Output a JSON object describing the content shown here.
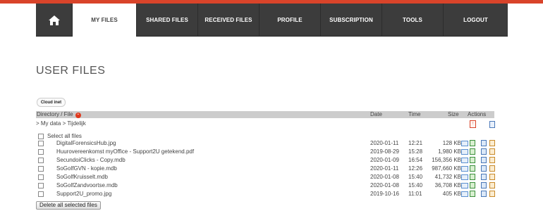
{
  "nav": {
    "items": [
      {
        "label": "MY FILES"
      },
      {
        "label": "SHARED FILES"
      },
      {
        "label": "RECEIVED FILES"
      },
      {
        "label": "PROFILE"
      },
      {
        "label": "SUBSCRIPTION"
      },
      {
        "label": "TOOLS"
      },
      {
        "label": "LOGOUT"
      }
    ],
    "home_icon": "home-icon",
    "active": "MY FILES"
  },
  "page": {
    "title": "USER FILES",
    "logo_text": "Cloud inet"
  },
  "table": {
    "headers": {
      "name": "Directory / File",
      "date": "Date",
      "time": "Time",
      "size": "Size",
      "actions": "Actions"
    },
    "breadcrumb": "> My data > Tijdelijk",
    "select_all": "Select all files",
    "files": [
      {
        "name": "DigitalForensicsHub.jpg",
        "date": "2020-01-11",
        "time": "12:21",
        "size": "128 KB"
      },
      {
        "name": "Huurovereenkomst myOffice - Support2U getekend.pdf",
        "date": "2019-08-29",
        "time": "15:28",
        "size": "1,980 KB"
      },
      {
        "name": "SecundoiClicks - Copy.mdb",
        "date": "2020-01-09",
        "time": "16:54",
        "size": "156,356 KB"
      },
      {
        "name": "SoGolfGVN - kopie.mdb",
        "date": "2020-01-11",
        "time": "12:26",
        "size": "987,660 KB"
      },
      {
        "name": "SoGolfKruisselt.mdb",
        "date": "2020-01-08",
        "time": "15:40",
        "size": "41,732 KB"
      },
      {
        "name": "SoGolfZandvoortse.mdb",
        "date": "2020-01-08",
        "time": "15:40",
        "size": "36,708 KB"
      },
      {
        "name": "Support2U_promo.jpg",
        "date": "2019-10-16",
        "time": "11:01",
        "size": "405 KB"
      }
    ],
    "delete_button": "Delete all selected files"
  },
  "colors": {
    "accent": "#d9442a",
    "nav_bg": "#3c3c3c",
    "header_bg": "#cccccc"
  }
}
